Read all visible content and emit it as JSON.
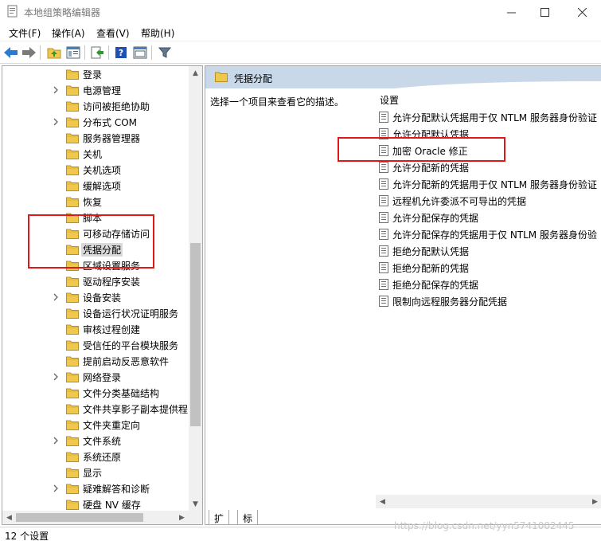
{
  "window": {
    "title": "本地组策略编辑器"
  },
  "menu": [
    "文件(F)",
    "操作(A)",
    "查看(V)",
    "帮助(H)"
  ],
  "toolbar": [
    "back-icon",
    "forward-icon",
    "up-folder-icon",
    "show-hide-tree-icon",
    "export-list-icon",
    "help-icon",
    "properties-icon",
    "filter-icon"
  ],
  "tree": {
    "items": [
      {
        "label": "登录",
        "expandable": false
      },
      {
        "label": "电源管理",
        "expandable": true
      },
      {
        "label": "访问被拒绝协助",
        "expandable": false
      },
      {
        "label": "分布式 COM",
        "expandable": true
      },
      {
        "label": "服务器管理器",
        "expandable": false
      },
      {
        "label": "关机",
        "expandable": false
      },
      {
        "label": "关机选项",
        "expandable": false
      },
      {
        "label": "缓解选项",
        "expandable": false
      },
      {
        "label": "恢复",
        "expandable": false
      },
      {
        "label": "脚本",
        "expandable": false
      },
      {
        "label": "可移动存储访问",
        "expandable": false
      },
      {
        "label": "凭据分配",
        "expandable": false,
        "selected": true
      },
      {
        "label": "区域设置服务",
        "expandable": false
      },
      {
        "label": "驱动程序安装",
        "expandable": false
      },
      {
        "label": "设备安装",
        "expandable": true
      },
      {
        "label": "设备运行状况证明服务",
        "expandable": false
      },
      {
        "label": "审核过程创建",
        "expandable": false
      },
      {
        "label": "受信任的平台模块服务",
        "expandable": false
      },
      {
        "label": "提前启动反恶意软件",
        "expandable": false
      },
      {
        "label": "网络登录",
        "expandable": true
      },
      {
        "label": "文件分类基础结构",
        "expandable": false
      },
      {
        "label": "文件共享影子副本提供程",
        "expandable": false
      },
      {
        "label": "文件夹重定向",
        "expandable": false
      },
      {
        "label": "文件系统",
        "expandable": true
      },
      {
        "label": "系统还原",
        "expandable": false
      },
      {
        "label": "显示",
        "expandable": false
      },
      {
        "label": "疑难解答和诊断",
        "expandable": true
      },
      {
        "label": "硬盘 NV 缓存",
        "expandable": false
      }
    ]
  },
  "right": {
    "header_title": "凭据分配",
    "description": "选择一个项目来查看它的描述。",
    "settings_header": "设置",
    "settings": [
      "允许分配默认凭据用于仅 NTLM 服务器身份验证",
      "允许分配默认凭据",
      "加密 Oracle 修正",
      "允许分配新的凭据",
      "允许分配新的凭据用于仅 NTLM 服务器身份验证",
      "远程机允许委派不可导出的凭据",
      "允许分配保存的凭据",
      "允许分配保存的凭据用于仅 NTLM 服务器身份验",
      "拒绝分配默认凭据",
      "拒绝分配新的凭据",
      "拒绝分配保存的凭据",
      "限制向远程服务器分配凭据"
    ]
  },
  "tabs": [
    "扩展",
    "标准"
  ],
  "status": "12 个设置",
  "watermark": "https://blog.csdn.net/yyn5741002445",
  "colors": {
    "annotation": "#e01818",
    "header_bg": "#c8d8e8",
    "folder": "#f0c850"
  }
}
